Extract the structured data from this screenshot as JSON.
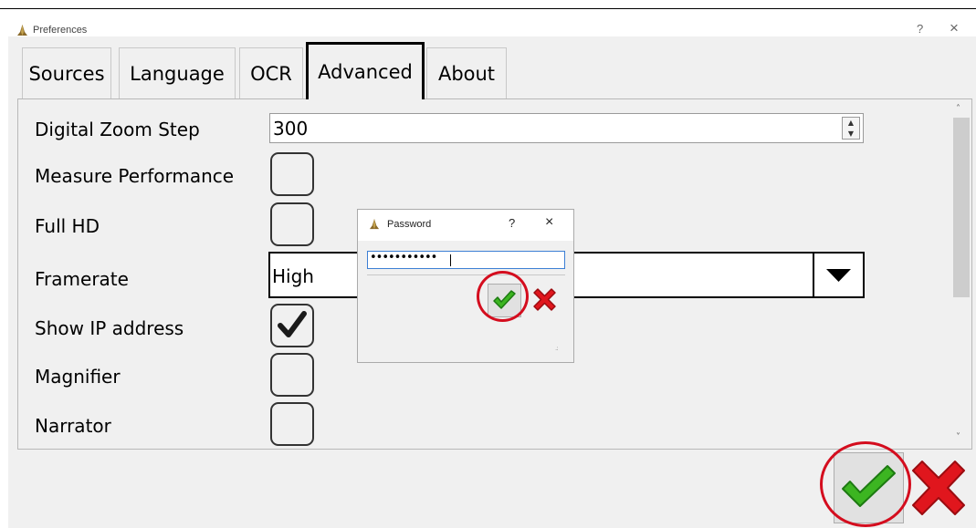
{
  "window": {
    "title": "Preferences",
    "help": "?",
    "close": "×"
  },
  "tabs": [
    {
      "label": "Sources",
      "active": false
    },
    {
      "label": "Language",
      "active": false
    },
    {
      "label": "OCR",
      "active": false
    },
    {
      "label": "Advanced",
      "active": true
    },
    {
      "label": "About",
      "active": false
    }
  ],
  "settings": {
    "digital_zoom_step": {
      "label": "Digital Zoom Step",
      "value": "300"
    },
    "measure_performance": {
      "label": "Measure Performance",
      "checked": false
    },
    "full_hd": {
      "label": "Full HD",
      "checked": false
    },
    "framerate": {
      "label": "Framerate",
      "value": "High"
    },
    "show_ip_address": {
      "label": "Show IP address",
      "checked": true
    },
    "magnifier": {
      "label": "Magnifier",
      "checked": false
    },
    "narrator": {
      "label": "Narrator",
      "checked": false
    }
  },
  "password_dialog": {
    "title": "Password",
    "help": "?",
    "close": "×",
    "masked_value": "•••••••••••"
  },
  "colors": {
    "highlight_ring": "#d40d1e",
    "ok_green": "#3cb521",
    "cancel_red": "#e0161d",
    "focus_blue": "#3c7fd4"
  },
  "icons": [
    "app-icon",
    "checkmark-icon",
    "cancel-x-icon",
    "dropdown-arrow-icon",
    "spin-up-icon",
    "spin-down-icon"
  ]
}
